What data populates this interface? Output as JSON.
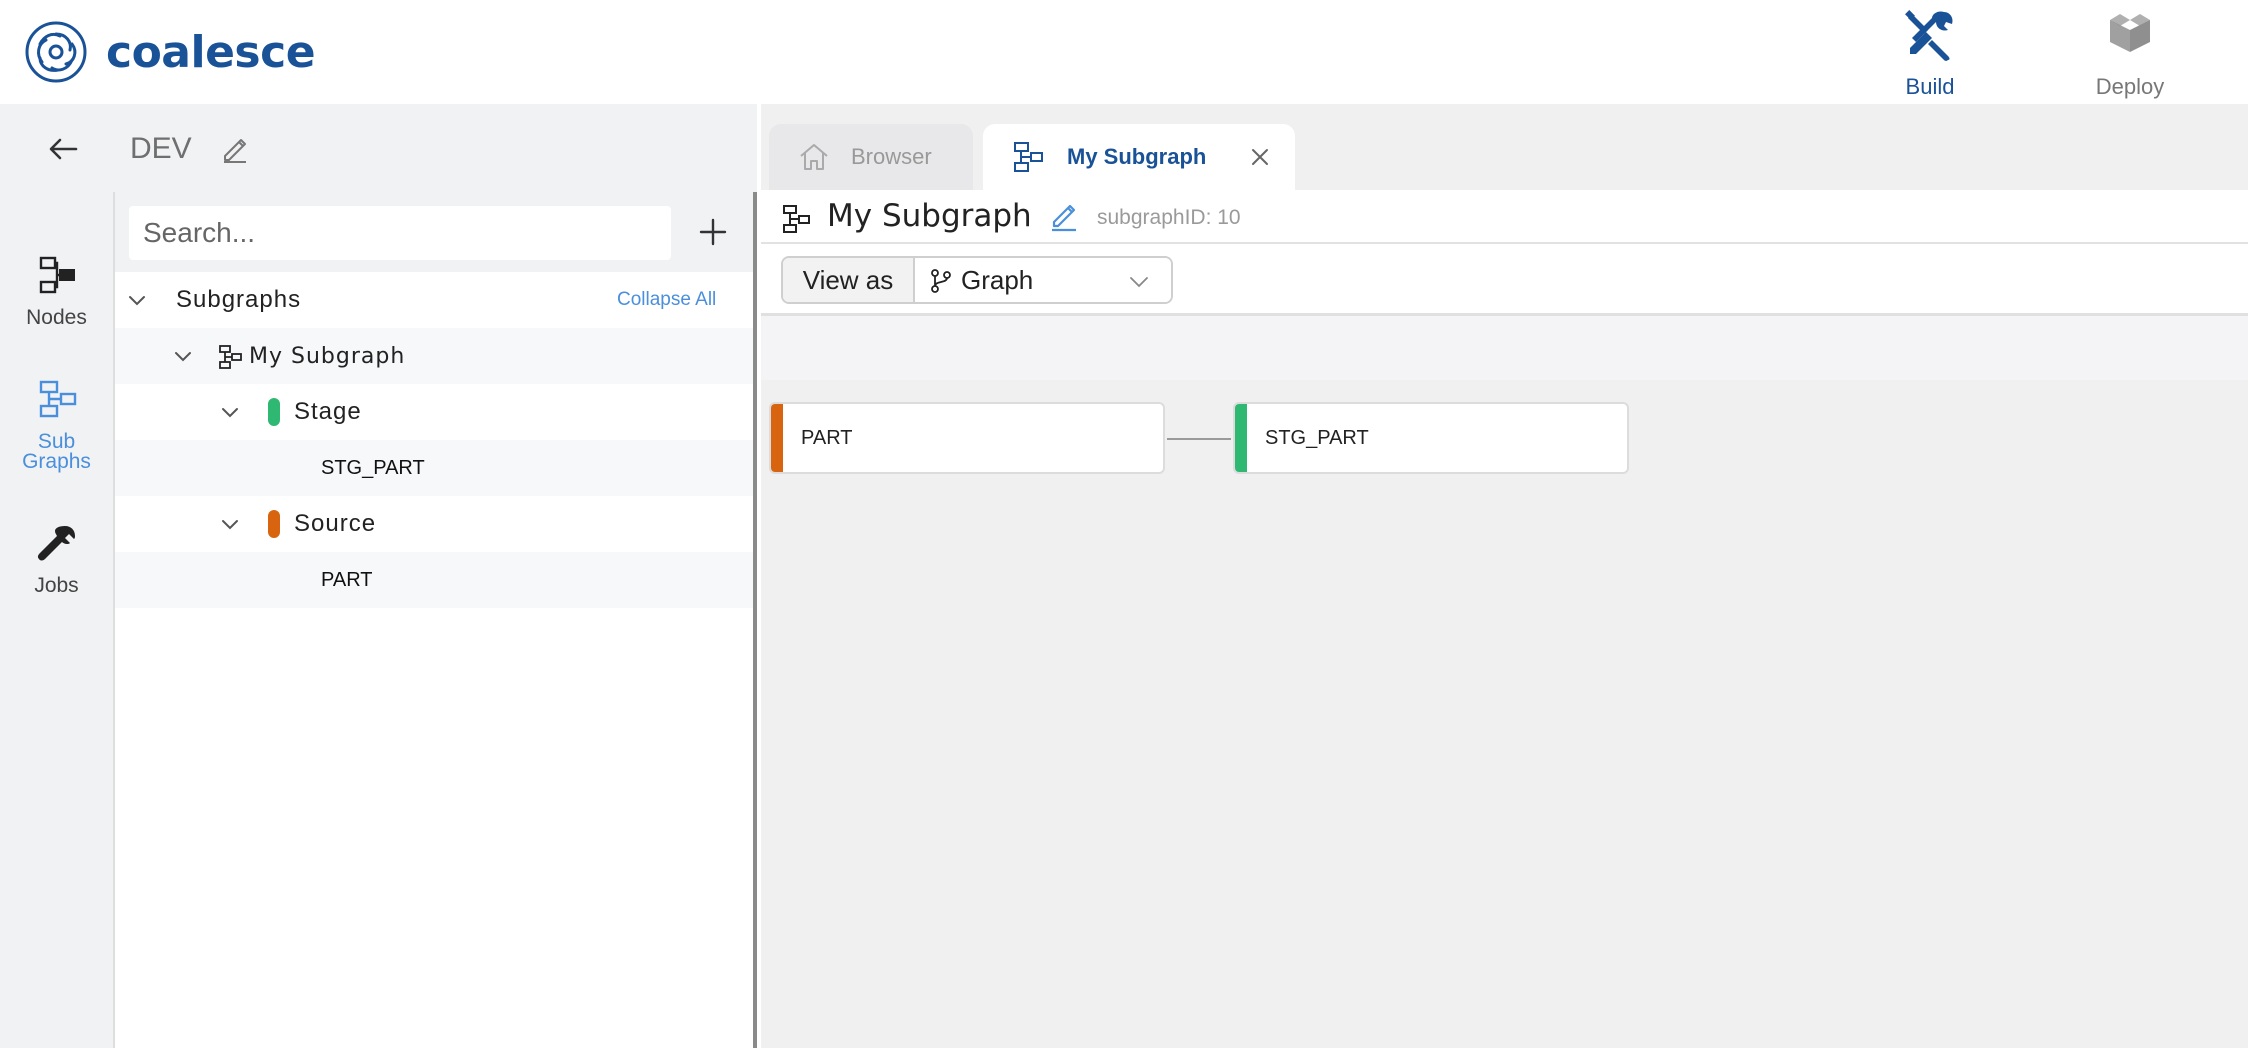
{
  "app": {
    "logo_text": "coalesce",
    "brand_color": "#1a5298",
    "accent_color": "#4a8fdc"
  },
  "topnav": {
    "build_label": "Build",
    "deploy_label": "Deploy"
  },
  "workspace": {
    "name": "DEV"
  },
  "rail": {
    "nodes_label": "Nodes",
    "subgraphs_label_1": "Sub",
    "subgraphs_label_2": "Graphs",
    "jobs_label": "Jobs"
  },
  "search": {
    "placeholder": "Search..."
  },
  "tree": {
    "root_label": "Subgraphs",
    "collapse_all": "Collapse All",
    "subgraph_label": "My Subgraph",
    "groups": [
      {
        "label": "Stage",
        "color": "#2eb872",
        "items": [
          "STG_PART"
        ]
      },
      {
        "label": "Source",
        "color": "#d9640f",
        "items": [
          "PART"
        ]
      }
    ]
  },
  "tabs": [
    {
      "label": "Browser",
      "icon": "home-icon",
      "active": false
    },
    {
      "label": "My Subgraph",
      "icon": "subgraph-icon",
      "active": true
    }
  ],
  "editor": {
    "title": "My Subgraph",
    "subgraph_id_text": "subgraphID: 10",
    "view_as_label": "View as",
    "view_as_value": "Graph"
  },
  "graph": {
    "nodes": [
      {
        "label": "PART",
        "color": "#d9640f",
        "type": "Source"
      },
      {
        "label": "STG_PART",
        "color": "#2eb872",
        "type": "Stage"
      }
    ],
    "edges": [
      {
        "from": "PART",
        "to": "STG_PART"
      }
    ]
  }
}
